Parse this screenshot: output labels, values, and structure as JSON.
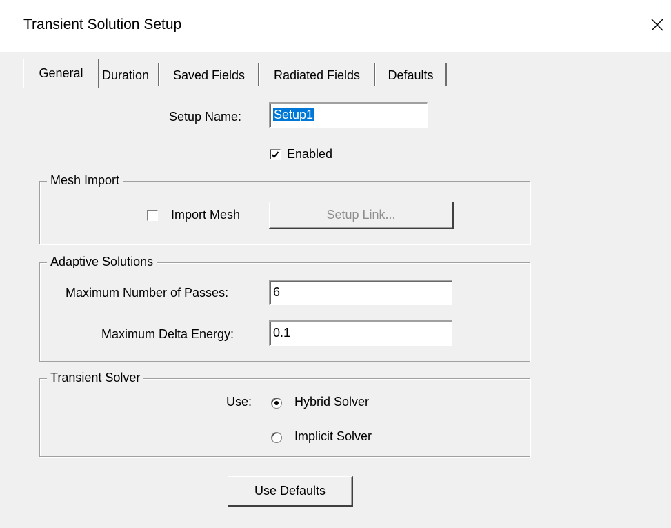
{
  "window": {
    "title": "Transient Solution Setup",
    "close_icon": "close-icon"
  },
  "tabs": [
    {
      "label": "General",
      "active": true
    },
    {
      "label": "Duration",
      "active": false
    },
    {
      "label": "Saved Fields",
      "active": false
    },
    {
      "label": "Radiated Fields",
      "active": false
    },
    {
      "label": "Defaults",
      "active": false
    }
  ],
  "general": {
    "setup_name_label": "Setup Name:",
    "setup_name_value": "Setup1",
    "enabled_label": "Enabled",
    "enabled_checked": true
  },
  "mesh_import": {
    "group_label": "Mesh Import",
    "import_mesh_label": "Import Mesh",
    "import_mesh_checked": false,
    "setup_link_label": "Setup Link..."
  },
  "adaptive": {
    "group_label": "Adaptive Solutions",
    "max_passes_label": "Maximum Number of Passes:",
    "max_passes_value": "6",
    "max_delta_label": "Maximum Delta Energy:",
    "max_delta_value": "0.1"
  },
  "solver": {
    "group_label": "Transient Solver",
    "use_label": "Use:",
    "options": [
      {
        "label": "Hybrid Solver",
        "selected": true
      },
      {
        "label": "Implicit Solver",
        "selected": false
      }
    ]
  },
  "actions": {
    "use_defaults_label": "Use Defaults"
  }
}
